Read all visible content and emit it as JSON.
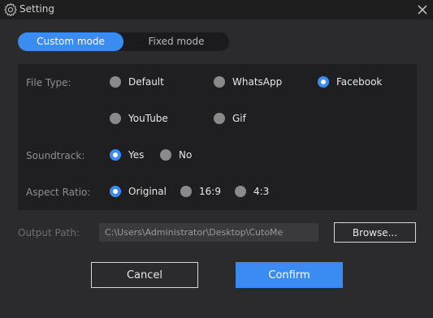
{
  "window": {
    "title": "Setting",
    "icon": "gear-icon",
    "close_icon": "close-icon"
  },
  "modes": {
    "custom_label": "Custom mode",
    "fixed_label": "Fixed mode",
    "selected": "Custom mode"
  },
  "file_type": {
    "label": "File Type:",
    "options": [
      "Default",
      "WhatsApp",
      "Facebook",
      "YouTube",
      "Gif"
    ],
    "selected": "Facebook"
  },
  "soundtrack": {
    "label": "Soundtrack:",
    "options": [
      "Yes",
      "No"
    ],
    "selected": "Yes"
  },
  "aspect_ratio": {
    "label": "Aspect Ratio:",
    "options": [
      "Original",
      "16:9",
      "4:3"
    ],
    "selected": "Original"
  },
  "output": {
    "label": "Output Path:",
    "path": "C:\\Users\\Administrator\\Desktop\\CutoMe",
    "browse_label": "Browse..."
  },
  "actions": {
    "cancel_label": "Cancel",
    "confirm_label": "Confirm"
  },
  "colors": {
    "accent": "#3b8cf2",
    "background": "#2b2b2e",
    "panel": "#1f1f21"
  }
}
